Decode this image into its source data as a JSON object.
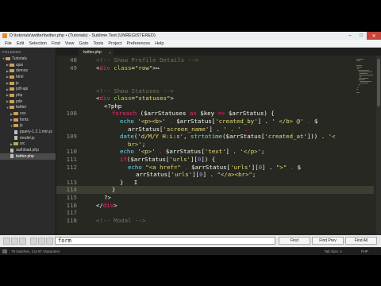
{
  "window": {
    "title": "D:\\tutorials\\twitter\\twitter.php • (Tutorials) - Sublime Text (UNREGISTERED)"
  },
  "menu": [
    "File",
    "Edit",
    "Selection",
    "Find",
    "View",
    "Goto",
    "Tools",
    "Project",
    "Preferences",
    "Help"
  ],
  "sidebar": {
    "header": "FOLDERS",
    "items": [
      {
        "label": "Tutorials",
        "kind": "folder",
        "depth": 0,
        "open": true
      },
      {
        "label": "ajax",
        "kind": "folder",
        "depth": 1,
        "open": false
      },
      {
        "label": "demos",
        "kind": "folder",
        "depth": 1,
        "open": false
      },
      {
        "label": "html",
        "kind": "folder",
        "depth": 1,
        "open": false
      },
      {
        "label": "js",
        "kind": "folder",
        "depth": 1,
        "open": false
      },
      {
        "label": "pdf-api",
        "kind": "folder",
        "depth": 1,
        "open": false
      },
      {
        "label": "php",
        "kind": "folder",
        "depth": 1,
        "open": false
      },
      {
        "label": "pdo",
        "kind": "folder",
        "depth": 1,
        "open": false
      },
      {
        "label": "twitter",
        "kind": "folder",
        "depth": 1,
        "open": true
      },
      {
        "label": "css",
        "kind": "folder",
        "depth": 2,
        "open": false
      },
      {
        "label": "fonts",
        "kind": "folder",
        "depth": 2,
        "open": false
      },
      {
        "label": "js",
        "kind": "folder",
        "depth": 2,
        "open": true
      },
      {
        "label": "jquery-1.2.1.min.js",
        "kind": "file",
        "depth": 3
      },
      {
        "label": "model.js",
        "kind": "file",
        "depth": 3
      },
      {
        "label": "src",
        "kind": "folder",
        "depth": 2,
        "open": false
      },
      {
        "label": "authload.php",
        "kind": "file",
        "depth": 2
      },
      {
        "label": "twitter.php",
        "kind": "file",
        "depth": 2,
        "selected": true
      }
    ]
  },
  "tab": {
    "label": "twitter.php",
    "close": "×"
  },
  "editor": {
    "current_line": 114,
    "lines": [
      {
        "n": "48",
        "indent": 2,
        "tokens": [
          [
            "<!-- Show Profile Details -->",
            "#75715e"
          ]
        ]
      },
      {
        "n": "49",
        "indent": 2,
        "tokens": [
          [
            "<",
            "#f8f8f2"
          ],
          [
            "div",
            "#f92672"
          ],
          [
            " ",
            "#f8f8f2"
          ],
          [
            "class",
            "#a6e22e"
          ],
          [
            "=",
            "#f8f8f2"
          ],
          [
            "\"row\"",
            "#e6db74"
          ],
          [
            ">",
            "#f8f8f2"
          ],
          [
            "⇔",
            "#f8f8f2"
          ]
        ]
      },
      {
        "n": "",
        "indent": 0,
        "tokens": []
      },
      {
        "n": "",
        "indent": 0,
        "tokens": []
      },
      {
        "n": "",
        "indent": 2,
        "tokens": [
          [
            "<!-- Show Statuses -->",
            "#75715e"
          ]
        ]
      },
      {
        "n": "",
        "indent": 2,
        "tokens": [
          [
            "<",
            "#f8f8f2"
          ],
          [
            "div",
            "#f92672"
          ],
          [
            " ",
            "#f8f8f2"
          ],
          [
            "class",
            "#a6e22e"
          ],
          [
            "=",
            "#f8f8f2"
          ],
          [
            "\"statuses\"",
            "#e6db74"
          ],
          [
            ">",
            "#f8f8f2"
          ]
        ]
      },
      {
        "n": "",
        "indent": 3,
        "tokens": [
          [
            "<?php",
            "#f8f8f2"
          ]
        ]
      },
      {
        "n": "108",
        "indent": 4,
        "tokens": [
          [
            "foreach",
            "#f92672"
          ],
          [
            " (",
            "#f8f8f2"
          ],
          [
            "$arrStatuses",
            "#f8f8f2"
          ],
          [
            " as ",
            "#f92672"
          ],
          [
            "$key",
            "#f8f8f2"
          ],
          [
            " => ",
            "#f92672"
          ],
          [
            "$arrStatus",
            "#f8f8f2"
          ],
          [
            ") {",
            "#f8f8f2"
          ]
        ]
      },
      {
        "n": "",
        "indent": 5,
        "tokens": [
          [
            "echo",
            "#66d9ef"
          ],
          [
            " ",
            "#f8f8f2"
          ],
          [
            "'<p><b>'",
            "#e6db74"
          ],
          [
            " . ",
            "#f92672"
          ],
          [
            "$arrStatus[",
            "#f8f8f2"
          ],
          [
            "'created_by'",
            "#e6db74"
          ],
          [
            "] . ",
            "#f8f8f2"
          ],
          [
            "' </b> @'",
            "#e6db74"
          ],
          [
            " . ",
            "#f92672"
          ],
          [
            "$",
            "#f8f8f2"
          ]
        ]
      },
      {
        "n": "",
        "indent": 6,
        "tokens": [
          [
            "arrStatus[",
            "#f8f8f2"
          ],
          [
            "'screen_name'",
            "#e6db74"
          ],
          [
            "] . ",
            "#f8f8f2"
          ],
          [
            "' . '",
            "#e6db74"
          ],
          [
            " .",
            "#f92672"
          ]
        ]
      },
      {
        "n": "109",
        "indent": 5,
        "tokens": [
          [
            "date",
            "#66d9ef"
          ],
          [
            "(",
            "#f8f8f2"
          ],
          [
            "'d/M/Y H:i:s'",
            "#e6db74"
          ],
          [
            ", ",
            "#f8f8f2"
          ],
          [
            "strtotime",
            "#66d9ef"
          ],
          [
            "($arrStatus[",
            "#f8f8f2"
          ],
          [
            "'created_at'",
            "#e6db74"
          ],
          [
            "])) . ",
            "#f8f8f2"
          ],
          [
            "'<",
            "#e6db74"
          ]
        ]
      },
      {
        "n": "",
        "indent": 6,
        "tokens": [
          [
            "br>'",
            "#e6db74"
          ],
          [
            ";",
            "#f8f8f2"
          ]
        ]
      },
      {
        "n": "110",
        "indent": 5,
        "tokens": [
          [
            "echo",
            "#66d9ef"
          ],
          [
            " ",
            "#f8f8f2"
          ],
          [
            "'<p>'",
            "#e6db74"
          ],
          [
            " . ",
            "#f92672"
          ],
          [
            "$arrStatus[",
            "#f8f8f2"
          ],
          [
            "'text'",
            "#e6db74"
          ],
          [
            "] . ",
            "#f8f8f2"
          ],
          [
            "'</p>'",
            "#e6db74"
          ],
          [
            ";",
            "#f8f8f2"
          ]
        ]
      },
      {
        "n": "111",
        "indent": 5,
        "tokens": [
          [
            "if",
            "#f92672"
          ],
          [
            "($arrStatus[",
            "#f8f8f2"
          ],
          [
            "'urls'",
            "#e6db74"
          ],
          [
            "][",
            "#f8f8f2"
          ],
          [
            "0",
            "#ae81ff"
          ],
          [
            "]) {",
            "#f8f8f2"
          ]
        ]
      },
      {
        "n": "112",
        "indent": 6,
        "tokens": [
          [
            "echo",
            "#66d9ef"
          ],
          [
            " ",
            "#f8f8f2"
          ],
          [
            "\"<a href=\"",
            "#e6db74"
          ],
          [
            " . ",
            "#f92672"
          ],
          [
            "$arrStatus[",
            "#f8f8f2"
          ],
          [
            "'urls'",
            "#e6db74"
          ],
          [
            "][",
            "#f8f8f2"
          ],
          [
            "0",
            "#ae81ff"
          ],
          [
            "] . ",
            "#f8f8f2"
          ],
          [
            "\">\"",
            "#e6db74"
          ],
          [
            " . ",
            "#f92672"
          ],
          [
            "$",
            "#f8f8f2"
          ]
        ]
      },
      {
        "n": "",
        "indent": 7,
        "tokens": [
          [
            "arrStatus[",
            "#f8f8f2"
          ],
          [
            "'urls'",
            "#e6db74"
          ],
          [
            "][",
            "#f8f8f2"
          ],
          [
            "0",
            "#ae81ff"
          ],
          [
            "] . ",
            "#f8f8f2"
          ],
          [
            "\"</a><br>\"",
            "#e6db74"
          ],
          [
            ";",
            "#f8f8f2"
          ]
        ]
      },
      {
        "n": "113",
        "indent": 5,
        "tokens": [
          [
            "}",
            "#f8f8f2"
          ],
          [
            "   I",
            "#f8f8f2"
          ]
        ]
      },
      {
        "n": "114",
        "indent": 4,
        "tokens": [
          [
            "}",
            "#f8f8f2"
          ]
        ]
      },
      {
        "n": "115",
        "indent": 3,
        "tokens": [
          [
            "?>",
            "#f8f8f2"
          ]
        ]
      },
      {
        "n": "116",
        "indent": 2,
        "tokens": [
          [
            "</",
            "#f8f8f2"
          ],
          [
            "div",
            "#f92672"
          ],
          [
            ">",
            "#f8f8f2"
          ]
        ]
      },
      {
        "n": "117",
        "indent": 0,
        "tokens": []
      },
      {
        "n": "118",
        "indent": 2,
        "tokens": [
          [
            "<!-- Modal -->",
            "#75715e"
          ]
        ]
      }
    ]
  },
  "find": {
    "value": "form",
    "find_label": "Find",
    "find_prev_label": "Find Prev",
    "find_all_label": "Find All"
  },
  "status": {
    "left": "78 matches, Cut 87 characters",
    "tab_size": "Tab Size: 4",
    "syntax": "PHP"
  }
}
